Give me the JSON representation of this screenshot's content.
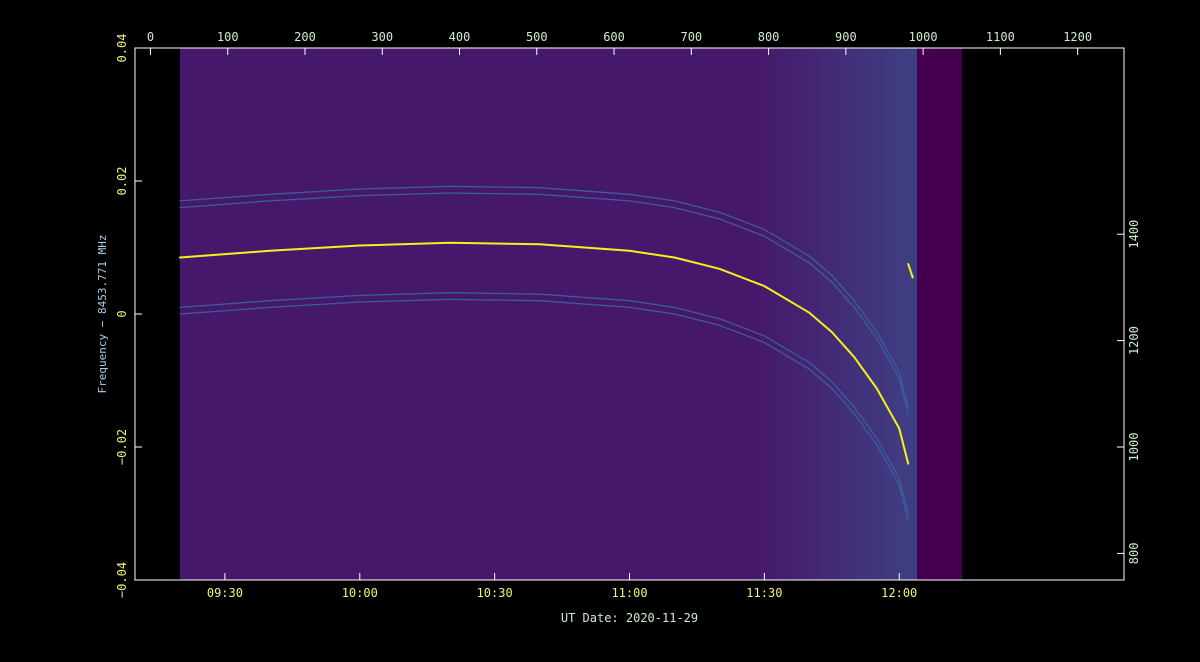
{
  "chart_data": {
    "type": "heatmap",
    "title": "",
    "xlabel": "UT Date: 2020-11-29",
    "ylabel": "Frequency − 8453.771 MHz",
    "bottom_axis": {
      "unit": "UT time",
      "range": [
        "09:10",
        "12:50"
      ],
      "ticks": [
        "09:30",
        "10:00",
        "10:30",
        "11:00",
        "11:30",
        "12:00"
      ]
    },
    "top_axis": {
      "unit": "sample index",
      "range": [
        -20,
        1260
      ],
      "ticks": [
        0,
        100,
        200,
        300,
        400,
        500,
        600,
        700,
        800,
        900,
        1000,
        1100,
        1200
      ]
    },
    "left_axis": {
      "unit": "MHz offset",
      "range": [
        -0.04,
        0.04
      ],
      "ticks": [
        -0.04,
        -0.02,
        0,
        0.02,
        0.04
      ],
      "tick_labels": [
        "−0.04",
        "−0.02",
        "0",
        "0.02",
        "0.04"
      ]
    },
    "right_axis": {
      "unit": "channel",
      "range": [
        750,
        1750
      ],
      "ticks": [
        800,
        1000,
        1200,
        1400
      ]
    },
    "data_extent": {
      "time_start": "09:20",
      "time_data_end": "12:04",
      "time_flag_end": "12:14"
    },
    "series": [
      {
        "role": "main-carrier",
        "color": "#f4f21a",
        "time": [
          "09:20",
          "09:40",
          "10:00",
          "10:20",
          "10:40",
          "11:00",
          "11:10",
          "11:20",
          "11:30",
          "11:40",
          "11:45",
          "11:50",
          "11:55",
          "12:00",
          "12:02"
        ],
        "freq_mhz": [
          0.0085,
          0.0095,
          0.0103,
          0.0107,
          0.0105,
          0.0095,
          0.0085,
          0.0068,
          0.0042,
          0.0002,
          -0.0027,
          -0.0065,
          -0.0112,
          -0.0172,
          -0.0225
        ]
      },
      {
        "role": "upper-sideband-a",
        "color": "#3a5e9a",
        "time": [
          "09:20",
          "09:40",
          "10:00",
          "10:20",
          "10:40",
          "11:00",
          "11:10",
          "11:20",
          "11:30",
          "11:40",
          "11:45",
          "11:50",
          "11:55",
          "12:00",
          "12:02"
        ],
        "freq_mhz": [
          0.017,
          0.018,
          0.0188,
          0.0192,
          0.019,
          0.018,
          0.017,
          0.0153,
          0.0127,
          0.0087,
          0.0058,
          0.002,
          -0.0027,
          -0.0087,
          -0.014
        ]
      },
      {
        "role": "upper-sideband-b",
        "color": "#3a5e9a",
        "time": [
          "09:20",
          "09:40",
          "10:00",
          "10:20",
          "10:40",
          "11:00",
          "11:10",
          "11:20",
          "11:30",
          "11:40",
          "11:45",
          "11:50",
          "11:55",
          "12:00",
          "12:02"
        ],
        "freq_mhz": [
          0.016,
          0.017,
          0.0178,
          0.0182,
          0.018,
          0.017,
          0.016,
          0.0143,
          0.0117,
          0.0077,
          0.0048,
          0.001,
          -0.0037,
          -0.0097,
          -0.015
        ]
      },
      {
        "role": "lower-sideband-a",
        "color": "#3a5e9a",
        "time": [
          "09:20",
          "09:40",
          "10:00",
          "10:20",
          "10:40",
          "11:00",
          "11:10",
          "11:20",
          "11:30",
          "11:40",
          "11:45",
          "11:50",
          "11:55",
          "12:00",
          "12:02"
        ],
        "freq_mhz": [
          0.001,
          0.002,
          0.0028,
          0.0032,
          0.003,
          0.002,
          0.001,
          -0.0007,
          -0.0033,
          -0.0073,
          -0.0102,
          -0.014,
          -0.0187,
          -0.0247,
          -0.03
        ]
      },
      {
        "role": "lower-sideband-b",
        "color": "#3a5e9a",
        "time": [
          "09:20",
          "09:40",
          "10:00",
          "10:20",
          "10:40",
          "11:00",
          "11:10",
          "11:20",
          "11:30",
          "11:40",
          "11:45",
          "11:50",
          "11:55",
          "12:00",
          "12:02"
        ],
        "freq_mhz": [
          0.0,
          0.001,
          0.0018,
          0.0022,
          0.002,
          0.001,
          0.0,
          -0.0017,
          -0.0043,
          -0.0083,
          -0.0112,
          -0.015,
          -0.0197,
          -0.0257,
          -0.031
        ]
      },
      {
        "role": "fragment",
        "color": "#f4f21a",
        "time": [
          "12:02",
          "12:03"
        ],
        "freq_mhz": [
          0.0075,
          0.0055
        ]
      }
    ],
    "colors": {
      "background": "#000000",
      "heatmap_low": "#46186b",
      "heatmap_high": "#3f3f84",
      "flagged": "#44004f",
      "axis": "#ffffff",
      "time_ticks": "#f2f279",
      "index_ticks": "#cfeccf",
      "freq_ticks": "#f2f279",
      "channel_ticks": "#cfeccf",
      "xlabel": "#cfeccf",
      "ylabel": "#a8cce8"
    },
    "grid": false,
    "legend": "none"
  }
}
